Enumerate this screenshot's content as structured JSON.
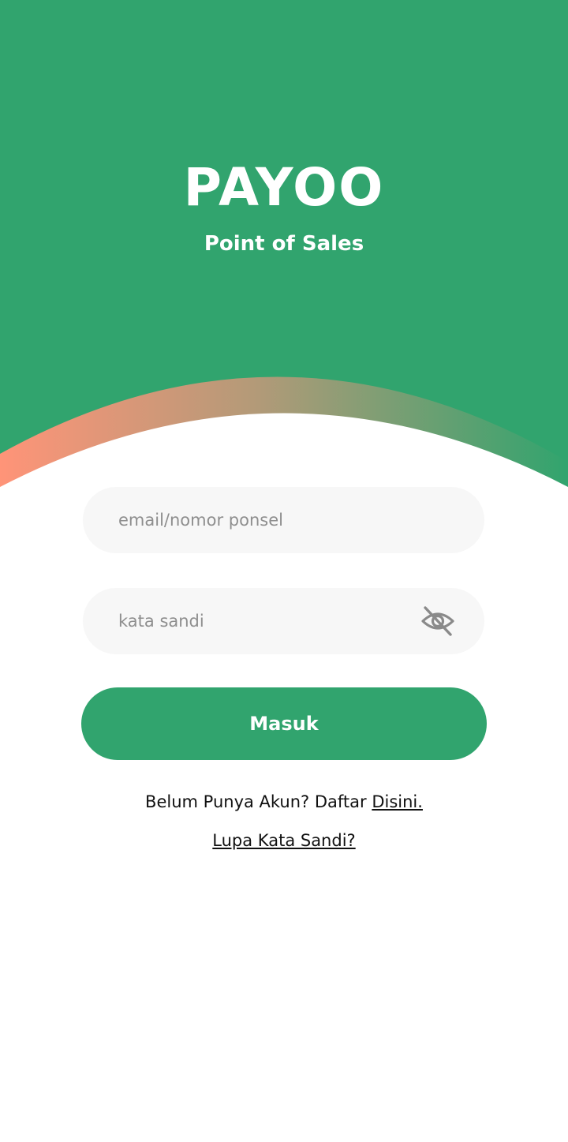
{
  "colors": {
    "brand_green": "#31a46e",
    "field_bg": "#f7f7f7",
    "arc_gradient_start": "#ff9478",
    "arc_gradient_end": "#31a46e",
    "text_dark": "#111111",
    "placeholder_gray": "#8e8e8e"
  },
  "header": {
    "brand": "PAYOO",
    "tagline": "Point of Sales"
  },
  "form": {
    "email_placeholder": "email/nomor ponsel",
    "email_value": "",
    "password_placeholder": "kata sandi",
    "password_value": "",
    "password_toggle_icon": "eye-slash-icon",
    "submit_label": "Masuk"
  },
  "footer": {
    "register_prompt": "Belum Punya Akun? Daftar ",
    "register_link": "Disini.",
    "forgot_link": "Lupa Kata Sandi?"
  }
}
